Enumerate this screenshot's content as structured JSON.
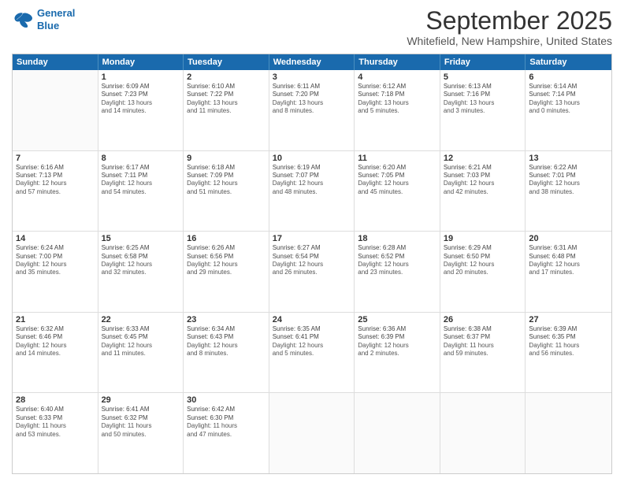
{
  "header": {
    "logo_line1": "General",
    "logo_line2": "Blue",
    "title": "September 2025",
    "location": "Whitefield, New Hampshire, United States"
  },
  "weekdays": [
    "Sunday",
    "Monday",
    "Tuesday",
    "Wednesday",
    "Thursday",
    "Friday",
    "Saturday"
  ],
  "rows": [
    [
      {
        "day": "",
        "sunrise": "",
        "sunset": "",
        "daylight": ""
      },
      {
        "day": "1",
        "sunrise": "Sunrise: 6:09 AM",
        "sunset": "Sunset: 7:23 PM",
        "daylight": "Daylight: 13 hours",
        "daylight2": "and 14 minutes."
      },
      {
        "day": "2",
        "sunrise": "Sunrise: 6:10 AM",
        "sunset": "Sunset: 7:22 PM",
        "daylight": "Daylight: 13 hours",
        "daylight2": "and 11 minutes."
      },
      {
        "day": "3",
        "sunrise": "Sunrise: 6:11 AM",
        "sunset": "Sunset: 7:20 PM",
        "daylight": "Daylight: 13 hours",
        "daylight2": "and 8 minutes."
      },
      {
        "day": "4",
        "sunrise": "Sunrise: 6:12 AM",
        "sunset": "Sunset: 7:18 PM",
        "daylight": "Daylight: 13 hours",
        "daylight2": "and 5 minutes."
      },
      {
        "day": "5",
        "sunrise": "Sunrise: 6:13 AM",
        "sunset": "Sunset: 7:16 PM",
        "daylight": "Daylight: 13 hours",
        "daylight2": "and 3 minutes."
      },
      {
        "day": "6",
        "sunrise": "Sunrise: 6:14 AM",
        "sunset": "Sunset: 7:14 PM",
        "daylight": "Daylight: 13 hours",
        "daylight2": "and 0 minutes."
      }
    ],
    [
      {
        "day": "7",
        "sunrise": "Sunrise: 6:16 AM",
        "sunset": "Sunset: 7:13 PM",
        "daylight": "Daylight: 12 hours",
        "daylight2": "and 57 minutes."
      },
      {
        "day": "8",
        "sunrise": "Sunrise: 6:17 AM",
        "sunset": "Sunset: 7:11 PM",
        "daylight": "Daylight: 12 hours",
        "daylight2": "and 54 minutes."
      },
      {
        "day": "9",
        "sunrise": "Sunrise: 6:18 AM",
        "sunset": "Sunset: 7:09 PM",
        "daylight": "Daylight: 12 hours",
        "daylight2": "and 51 minutes."
      },
      {
        "day": "10",
        "sunrise": "Sunrise: 6:19 AM",
        "sunset": "Sunset: 7:07 PM",
        "daylight": "Daylight: 12 hours",
        "daylight2": "and 48 minutes."
      },
      {
        "day": "11",
        "sunrise": "Sunrise: 6:20 AM",
        "sunset": "Sunset: 7:05 PM",
        "daylight": "Daylight: 12 hours",
        "daylight2": "and 45 minutes."
      },
      {
        "day": "12",
        "sunrise": "Sunrise: 6:21 AM",
        "sunset": "Sunset: 7:03 PM",
        "daylight": "Daylight: 12 hours",
        "daylight2": "and 42 minutes."
      },
      {
        "day": "13",
        "sunrise": "Sunrise: 6:22 AM",
        "sunset": "Sunset: 7:01 PM",
        "daylight": "Daylight: 12 hours",
        "daylight2": "and 38 minutes."
      }
    ],
    [
      {
        "day": "14",
        "sunrise": "Sunrise: 6:24 AM",
        "sunset": "Sunset: 7:00 PM",
        "daylight": "Daylight: 12 hours",
        "daylight2": "and 35 minutes."
      },
      {
        "day": "15",
        "sunrise": "Sunrise: 6:25 AM",
        "sunset": "Sunset: 6:58 PM",
        "daylight": "Daylight: 12 hours",
        "daylight2": "and 32 minutes."
      },
      {
        "day": "16",
        "sunrise": "Sunrise: 6:26 AM",
        "sunset": "Sunset: 6:56 PM",
        "daylight": "Daylight: 12 hours",
        "daylight2": "and 29 minutes."
      },
      {
        "day": "17",
        "sunrise": "Sunrise: 6:27 AM",
        "sunset": "Sunset: 6:54 PM",
        "daylight": "Daylight: 12 hours",
        "daylight2": "and 26 minutes."
      },
      {
        "day": "18",
        "sunrise": "Sunrise: 6:28 AM",
        "sunset": "Sunset: 6:52 PM",
        "daylight": "Daylight: 12 hours",
        "daylight2": "and 23 minutes."
      },
      {
        "day": "19",
        "sunrise": "Sunrise: 6:29 AM",
        "sunset": "Sunset: 6:50 PM",
        "daylight": "Daylight: 12 hours",
        "daylight2": "and 20 minutes."
      },
      {
        "day": "20",
        "sunrise": "Sunrise: 6:31 AM",
        "sunset": "Sunset: 6:48 PM",
        "daylight": "Daylight: 12 hours",
        "daylight2": "and 17 minutes."
      }
    ],
    [
      {
        "day": "21",
        "sunrise": "Sunrise: 6:32 AM",
        "sunset": "Sunset: 6:46 PM",
        "daylight": "Daylight: 12 hours",
        "daylight2": "and 14 minutes."
      },
      {
        "day": "22",
        "sunrise": "Sunrise: 6:33 AM",
        "sunset": "Sunset: 6:45 PM",
        "daylight": "Daylight: 12 hours",
        "daylight2": "and 11 minutes."
      },
      {
        "day": "23",
        "sunrise": "Sunrise: 6:34 AM",
        "sunset": "Sunset: 6:43 PM",
        "daylight": "Daylight: 12 hours",
        "daylight2": "and 8 minutes."
      },
      {
        "day": "24",
        "sunrise": "Sunrise: 6:35 AM",
        "sunset": "Sunset: 6:41 PM",
        "daylight": "Daylight: 12 hours",
        "daylight2": "and 5 minutes."
      },
      {
        "day": "25",
        "sunrise": "Sunrise: 6:36 AM",
        "sunset": "Sunset: 6:39 PM",
        "daylight": "Daylight: 12 hours",
        "daylight2": "and 2 minutes."
      },
      {
        "day": "26",
        "sunrise": "Sunrise: 6:38 AM",
        "sunset": "Sunset: 6:37 PM",
        "daylight": "Daylight: 11 hours",
        "daylight2": "and 59 minutes."
      },
      {
        "day": "27",
        "sunrise": "Sunrise: 6:39 AM",
        "sunset": "Sunset: 6:35 PM",
        "daylight": "Daylight: 11 hours",
        "daylight2": "and 56 minutes."
      }
    ],
    [
      {
        "day": "28",
        "sunrise": "Sunrise: 6:40 AM",
        "sunset": "Sunset: 6:33 PM",
        "daylight": "Daylight: 11 hours",
        "daylight2": "and 53 minutes."
      },
      {
        "day": "29",
        "sunrise": "Sunrise: 6:41 AM",
        "sunset": "Sunset: 6:32 PM",
        "daylight": "Daylight: 11 hours",
        "daylight2": "and 50 minutes."
      },
      {
        "day": "30",
        "sunrise": "Sunrise: 6:42 AM",
        "sunset": "Sunset: 6:30 PM",
        "daylight": "Daylight: 11 hours",
        "daylight2": "and 47 minutes."
      },
      {
        "day": "",
        "sunrise": "",
        "sunset": "",
        "daylight": ""
      },
      {
        "day": "",
        "sunrise": "",
        "sunset": "",
        "daylight": ""
      },
      {
        "day": "",
        "sunrise": "",
        "sunset": "",
        "daylight": ""
      },
      {
        "day": "",
        "sunrise": "",
        "sunset": "",
        "daylight": ""
      }
    ]
  ]
}
